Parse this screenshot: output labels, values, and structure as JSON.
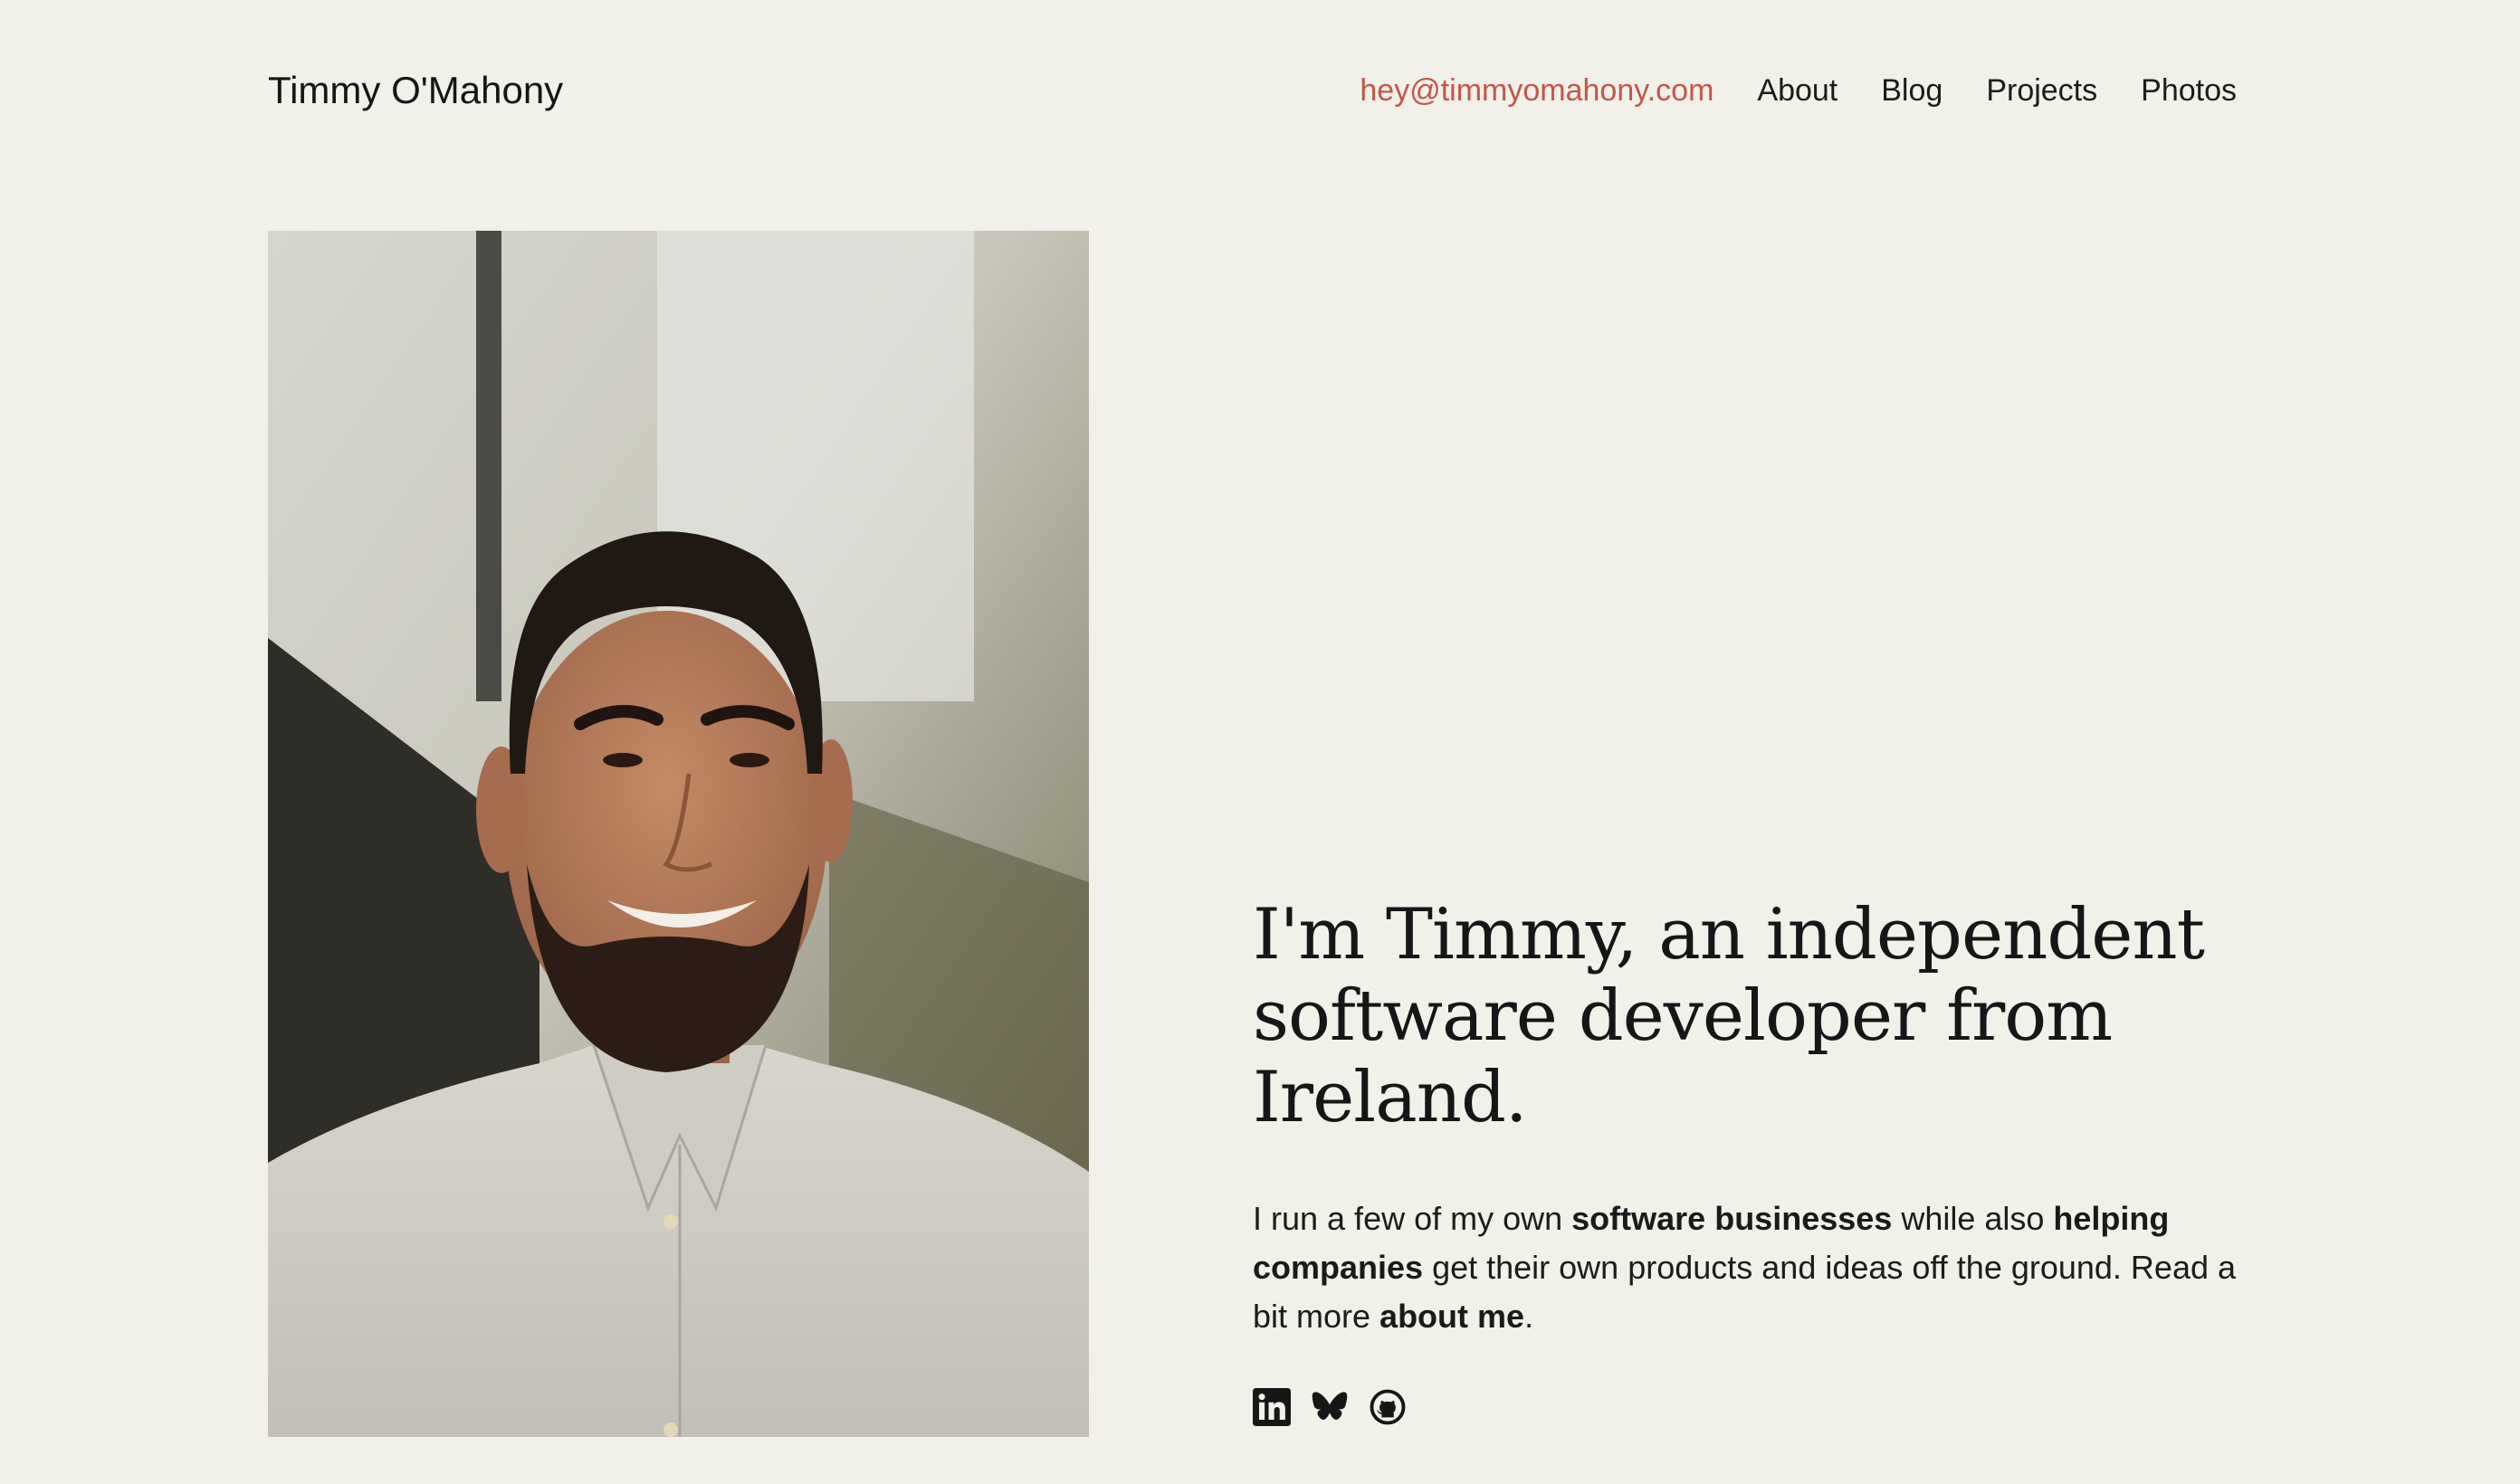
{
  "site": {
    "title": "Timmy O'Mahony"
  },
  "nav": {
    "email": "hey@timmyomahony.com",
    "items": [
      "About",
      "Blog",
      "Projects",
      "Photos"
    ]
  },
  "hero": {
    "headline": "I'm Timmy, an independent software developer from Ireland.",
    "intro": {
      "t1": "I run a few of my own ",
      "b1": "software businesses",
      "t2": " while also ",
      "b2": "helping companies",
      "t3": " get their own products and ideas off the ground. Read a bit more ",
      "link": "about me",
      "t4": "."
    }
  },
  "socials": {
    "items": [
      {
        "name": "linkedin-icon"
      },
      {
        "name": "bluesky-icon"
      },
      {
        "name": "github-icon"
      }
    ]
  },
  "colors": {
    "background": "#f1f0e9",
    "accent": "#c3564a",
    "text": "#1c1c1a"
  }
}
